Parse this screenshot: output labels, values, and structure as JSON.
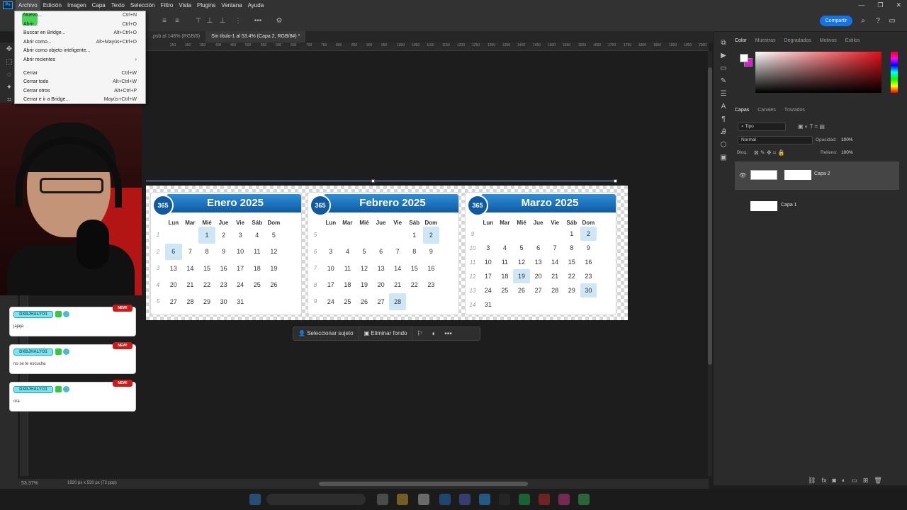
{
  "menubar": {
    "logo": "Ps",
    "items": [
      "Archivo",
      "Edición",
      "Imagen",
      "Capa",
      "Texto",
      "Selección",
      "Filtro",
      "Vista",
      "Plugins",
      "Ventana",
      "Ayuda"
    ]
  },
  "share_label": "Compartir",
  "tabs": [
    {
      "label": ".psb al 146% (RGB/8)"
    },
    {
      "label": "Sin título-1 al 53.4% (Capa 2, RGB/8#) *"
    }
  ],
  "ruler_ticks": [
    "250",
    "300",
    "350",
    "400",
    "450",
    "500",
    "550",
    "600",
    "650",
    "700",
    "750",
    "800",
    "850",
    "900",
    "950",
    "1000",
    "1050",
    "1100",
    "1150",
    "1200",
    "1250",
    "1300",
    "1350",
    "1400",
    "1450",
    "1500",
    "1550",
    "1600",
    "1650",
    "1700",
    "1750",
    "1800",
    "1850",
    "1900",
    "1950",
    "2000",
    "2050",
    "2100",
    "2150",
    "2200",
    "2250",
    "2300"
  ],
  "file_menu": {
    "items": [
      {
        "label": "Nuevo...",
        "shortcut": "Ctrl+N"
      },
      {
        "label": "Abrir...",
        "shortcut": "Ctrl+O"
      },
      {
        "label": "Buscar en Bridge...",
        "shortcut": "Alt+Ctrl+O"
      },
      {
        "label": "Abrir como...",
        "shortcut": "Alt+Mayús+Ctrl+O"
      },
      {
        "label": "Abrir como objeto inteligente...",
        "shortcut": ""
      },
      {
        "label": "Abrir recientes",
        "shortcut": "›"
      },
      {
        "label": "Cerrar",
        "shortcut": "Ctrl+W"
      },
      {
        "label": "Cerrar todo",
        "shortcut": "Alt+Ctrl+W"
      },
      {
        "label": "Cerrar otros",
        "shortcut": "Alt+Ctrl+P"
      },
      {
        "label": "Cerrar e ir a Bridge...",
        "shortcut": "Mayús+Ctrl+W"
      }
    ]
  },
  "calendar": {
    "badge": "365",
    "headers": [
      "Lun",
      "Mar",
      "Mié",
      "Jue",
      "Vie",
      "Sáb",
      "Dom"
    ],
    "months": [
      {
        "title": "Enero 2025",
        "rows": [
          {
            "wk": "1",
            "days": [
              "",
              "",
              "1",
              "2",
              "3",
              "4",
              "5"
            ]
          },
          {
            "wk": "2",
            "days": [
              "6",
              "7",
              "8",
              "9",
              "10",
              "11",
              "12"
            ]
          },
          {
            "wk": "3",
            "days": [
              "13",
              "14",
              "15",
              "16",
              "17",
              "18",
              "19"
            ]
          },
          {
            "wk": "4",
            "days": [
              "20",
              "21",
              "22",
              "23",
              "24",
              "25",
              "26"
            ]
          },
          {
            "wk": "5",
            "days": [
              "27",
              "28",
              "29",
              "30",
              "31",
              "",
              ""
            ]
          }
        ]
      },
      {
        "title": "Febrero 2025",
        "rows": [
          {
            "wk": "5",
            "days": [
              "",
              "",
              "",
              "",
              "",
              "1",
              "2"
            ]
          },
          {
            "wk": "6",
            "days": [
              "3",
              "4",
              "5",
              "6",
              "7",
              "8",
              "9"
            ]
          },
          {
            "wk": "7",
            "days": [
              "10",
              "11",
              "12",
              "13",
              "14",
              "15",
              "16"
            ]
          },
          {
            "wk": "8",
            "days": [
              "17",
              "18",
              "19",
              "20",
              "21",
              "22",
              "23"
            ]
          },
          {
            "wk": "9",
            "days": [
              "24",
              "25",
              "26",
              "27",
              "28",
              "",
              ""
            ]
          }
        ]
      },
      {
        "title": "Marzo 2025",
        "rows": [
          {
            "wk": "9",
            "days": [
              "",
              "",
              "",
              "",
              "",
              "1",
              "2"
            ]
          },
          {
            "wk": "10",
            "days": [
              "3",
              "4",
              "5",
              "6",
              "7",
              "8",
              "9"
            ]
          },
          {
            "wk": "11",
            "days": [
              "10",
              "11",
              "12",
              "13",
              "14",
              "15",
              "16"
            ]
          },
          {
            "wk": "12",
            "days": [
              "17",
              "18",
              "19",
              "20",
              "21",
              "22",
              "23"
            ]
          },
          {
            "wk": "13",
            "days": [
              "24",
              "25",
              "26",
              "27",
              "28",
              "29",
              "30"
            ]
          },
          {
            "wk": "14",
            "days": [
              "31",
              "",
              "",
              "",
              "",
              "",
              ""
            ]
          }
        ]
      }
    ]
  },
  "context_bar": {
    "select_subject": "Seleccionar sujeto",
    "remove_bg": "Eliminar fondo"
  },
  "chat": [
    {
      "user": "DXBJHALYO1",
      "badge": "NEW!",
      "message": "jajaja"
    },
    {
      "user": "DXBJHALYO1",
      "badge": "NEW!",
      "message": "no se te escucha"
    },
    {
      "user": "DXBJHALYO1",
      "badge": "NEW!",
      "message": "ora"
    }
  ],
  "panels": {
    "color_tabs": [
      "Color",
      "Muestras",
      "Degradados",
      "Motivos",
      "Estilos"
    ],
    "layer_tabs": [
      "Capas",
      "Canales",
      "Trazados"
    ],
    "kind_filter": "Tipo",
    "blend_mode": "Normal",
    "opacity_label": "Opacidad:",
    "opacity_value": "100%",
    "lock_label": "Bloq.:",
    "fill_label": "Relleno:",
    "fill_value": "100%",
    "layers": [
      {
        "name": "Capa 2",
        "active": true
      },
      {
        "name": "Capa 1",
        "active": false
      }
    ]
  },
  "status": {
    "zoom": "53.37%",
    "doc_size": "1920 px x 530 px (72 ppp)"
  },
  "colors": {
    "accent": "#1473e6",
    "calendar_header": "#0f5aa3",
    "highlight": "#cfe6f7",
    "foreground": "#ffffff",
    "background_swatch": "#e018d8"
  }
}
